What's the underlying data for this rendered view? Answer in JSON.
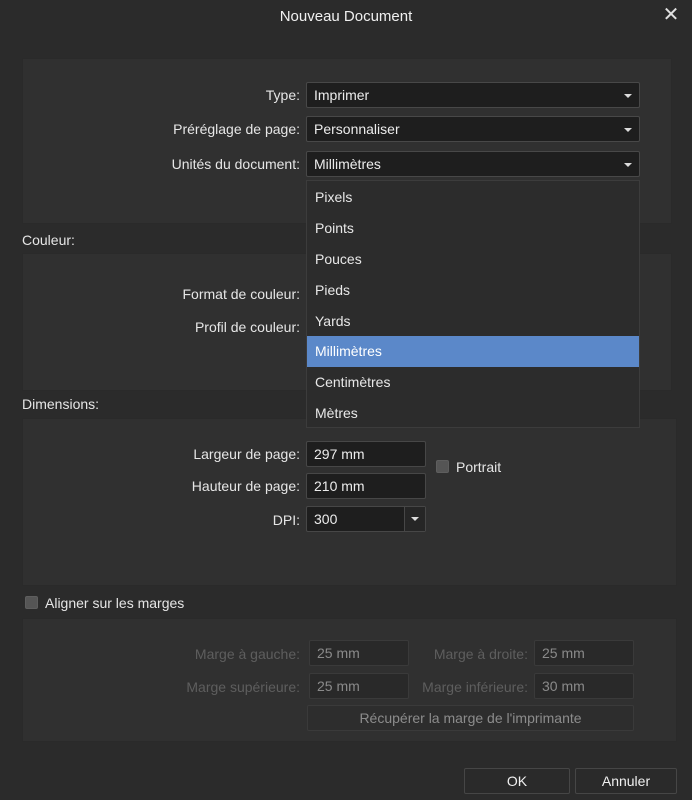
{
  "dialog": {
    "title": "Nouveau Document"
  },
  "document": {
    "type_label": "Type:",
    "type_value": "Imprimer",
    "preset_label": "Préréglage de page:",
    "preset_value": "Personnaliser",
    "units_label": "Unités du document:",
    "units_value": "Millimètres"
  },
  "units_dropdown": {
    "options": [
      "Pixels",
      "Points",
      "Pouces",
      "Pieds",
      "Yards",
      "Millimètres",
      "Centimètres",
      "Mètres"
    ],
    "selected": "Millimètres"
  },
  "color": {
    "section_label": "Couleur:",
    "format_label": "Format de couleur:",
    "profile_label": "Profil de couleur:"
  },
  "dimensions": {
    "section_label": "Dimensions:",
    "width_label": "Largeur de page:",
    "width_value": "297 mm",
    "height_label": "Hauteur de page:",
    "height_value": "210 mm",
    "dpi_label": "DPI:",
    "dpi_value": "300",
    "portrait_label": "Portrait"
  },
  "margins": {
    "align_label": "Aligner sur les marges",
    "left_label": "Marge à gauche:",
    "left_value": "25 mm",
    "right_label": "Marge à droite:",
    "right_value": "25 mm",
    "top_label": "Marge supérieure:",
    "top_value": "25 mm",
    "bottom_label": "Marge inférieure:",
    "bottom_value": "30 mm",
    "printer_button": "Récupérer la marge de l'imprimante"
  },
  "footer": {
    "ok_label": "OK",
    "cancel_label": "Annuler"
  },
  "colors": {
    "selection": "#5b88c9",
    "background": "#2b2b2b",
    "panel": "#303030",
    "field": "#1e1e1e"
  }
}
